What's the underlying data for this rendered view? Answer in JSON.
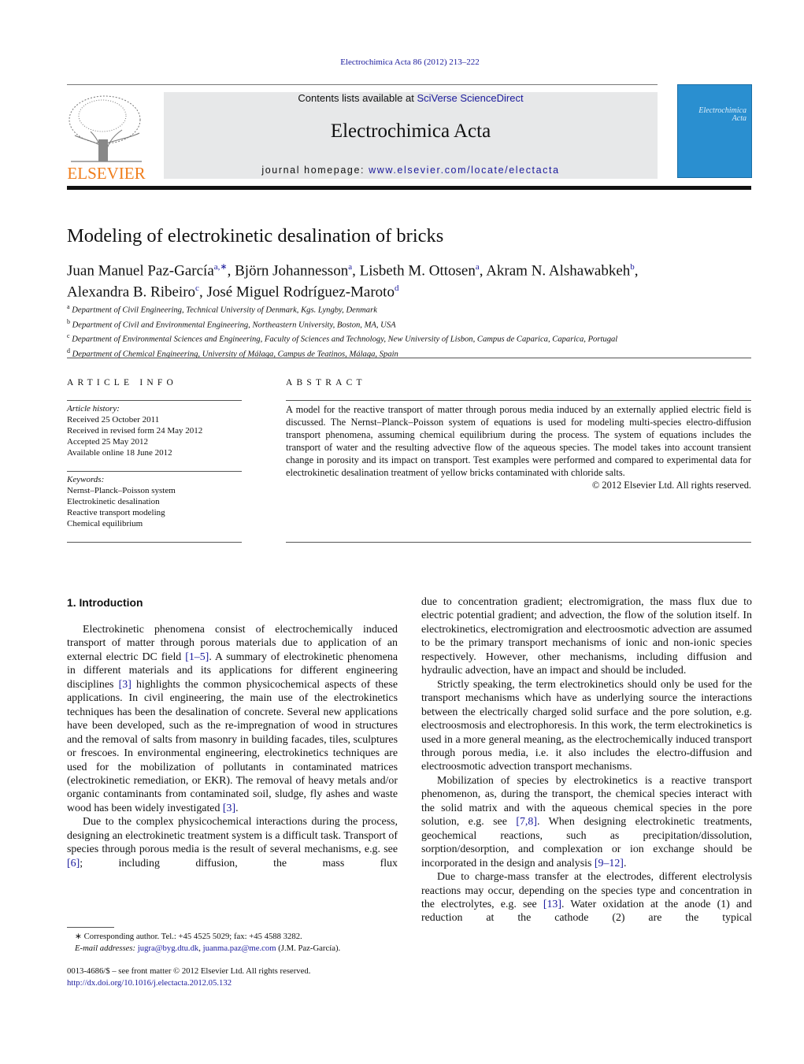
{
  "header": {
    "journal_ref": "Electrochimica Acta 86 (2012) 213–222",
    "contents_prefix": "Contents lists available at ",
    "contents_link": "SciVerse ScienceDirect",
    "journal_title": "Electrochimica Acta",
    "homepage_prefix": "journal homepage: ",
    "homepage_link": "www.elsevier.com/locate/electacta",
    "publisher_logo": "ELSEVIER",
    "cover_title": "Electrochimica Acta",
    "cover_color": "#2a8fd0"
  },
  "article": {
    "title": "Modeling of electrokinetic desalination of bricks",
    "authors": [
      {
        "name": "Juan Manuel Paz-García",
        "sup": "a,∗",
        "sep": ", "
      },
      {
        "name": "Björn Johannesson",
        "sup": "a",
        "sep": ", "
      },
      {
        "name": "Lisbeth M. Ottosen",
        "sup": "a",
        "sep": ", "
      },
      {
        "name": "Akram N. Alshawabkeh",
        "sup": "b",
        "sep": ","
      },
      {
        "name": "Alexandra B. Ribeiro",
        "sup": "c",
        "sep": ", "
      },
      {
        "name": "José Miguel Rodríguez-Maroto",
        "sup": "d",
        "sep": ""
      }
    ],
    "affiliations": [
      {
        "sup": "a",
        "text": "Department of Civil Engineering, Technical University of Denmark, Kgs. Lyngby, Denmark"
      },
      {
        "sup": "b",
        "text": "Department of Civil and Environmental Engineering, Northeastern University, Boston, MA, USA"
      },
      {
        "sup": "c",
        "text": "Department of Environmental Sciences and Engineering, Faculty of Sciences and Technology, New University of Lisbon, Campus de Caparica, Caparica, Portugal"
      },
      {
        "sup": "d",
        "text": "Department of Chemical Engineering, University of Málaga, Campus de Teatinos, Málaga, Spain"
      }
    ]
  },
  "article_info": {
    "heading": "ARTICLE INFO",
    "history_label": "Article history:",
    "history": [
      "Received 25 October 2011",
      "Received in revised form 24 May 2012",
      "Accepted 25 May 2012",
      "Available online 18 June 2012"
    ],
    "keywords_label": "Keywords:",
    "keywords": [
      "Nernst–Planck–Poisson system",
      "Electrokinetic desalination",
      "Reactive transport modeling",
      "Chemical equilibrium"
    ]
  },
  "abstract": {
    "heading": "ABSTRACT",
    "text": "A model for the reactive transport of matter through porous media induced by an externally applied electric field is discussed. The Nernst–Planck–Poisson system of equations is used for modeling multi-species electro-diffusion transport phenomena, assuming chemical equilibrium during the process. The system of equations includes the transport of water and the resulting advective flow of the aqueous species. The model takes into account transient change in porosity and its impact on transport. Test examples were performed and compared to experimental data for electrokinetic desalination treatment of yellow bricks contaminated with chloride salts.",
    "copyright": "© 2012 Elsevier Ltd. All rights reserved."
  },
  "body": {
    "section_heading": "1.  Introduction",
    "left_column": [
      {
        "style": "",
        "segments": [
          {
            "t": "Electrokinetic phenomena consist of electrochemically induced transport of matter through porous materials due to application of an external electric DC field "
          },
          {
            "t": "[1–5]",
            "ref": true
          },
          {
            "t": ". A summary of electrokinetic phe­nomena in different materials and its applications for different engineering disciplines "
          },
          {
            "t": "[3]",
            "ref": true
          },
          {
            "t": " highlights the common physicochem­ical aspects of these applications. In civil engineering, the main use of the electrokinetics techniques has been the desalination of concrete. Several new applications have been developed, such as the re-impregnation of wood in structures and the removal of salts from masonry in building facades, tiles, sculptures or fres­coes. In environmental engineering, electrokinetics techniques are used for the mobilization of pollutants in contaminated matri­ces (electrokinetic remediation, or EKR). The removal of heavy metals and/or organic contaminants from contaminated soil, sludge, fly ashes and waste wood has been widely investigated "
          },
          {
            "t": "[3]",
            "ref": true
          },
          {
            "t": "."
          }
        ]
      },
      {
        "style": "cont",
        "segments": [
          {
            "t": "Due to the complex physicochemical interactions during the process, designing an electrokinetic treatment system is a difficult task. Transport of species through porous media is the result of several mechanisms, e.g. see "
          },
          {
            "t": "[6]",
            "ref": true
          },
          {
            "t": "; including diffusion, the mass flux"
          }
        ]
      }
    ],
    "right_column": [
      {
        "style": "noind",
        "segments": [
          {
            "t": "due to concentration gradient; electromigration, the mass flux due to electric potential gradient; and advection, the flow of the solu­tion itself. In electrokinetics, electromigration and electroosmotic advection are assumed to be the primary transport mechanisms of ionic and non-ionic species respectively. However, other mecha­nisms, including diffusion and hydraulic advection, have an impact and should be included."
          }
        ]
      },
      {
        "style": "",
        "segments": [
          {
            "t": "Strictly speaking, the term electrokinetics should only be used for the transport mechanisms which have as underlying source the interactions between the electrically charged solid surface and the pore solution, e.g. electroosmosis and electrophoresis. In this work, the term electrokinetics is used in a more general meaning, as the electrochemically induced transport through porous media, i.e. it also includes the electro-diffusion and electroosmotic advection transport mechanisms."
          }
        ]
      },
      {
        "style": "",
        "segments": [
          {
            "t": "Mobilization of species by electrokinetics is a reactive trans­port phenomenon, as, during the transport, the chemical species interact with the solid matrix and with the aqueous chemi­cal species in the pore solution, e.g. see "
          },
          {
            "t": "[7,8]",
            "ref": true
          },
          {
            "t": ". When designing electrokinetic treatments, geochemical reactions, such as precip­itation/dissolution, sorption/desorption, and complexation or ion exchange should be incorporated in the design and analysis "
          },
          {
            "t": "[9–12]",
            "ref": true
          },
          {
            "t": "."
          }
        ]
      },
      {
        "style": "cont",
        "segments": [
          {
            "t": "Due to charge-mass transfer at the electrodes, different elec­trolysis reactions may occur, depending on the species type and concentration in the electrolytes, e.g. see "
          },
          {
            "t": "[13]",
            "ref": true
          },
          {
            "t": ". Water oxidation at the anode (1) and reduction at the cathode (2) are the typical"
          }
        ]
      }
    ]
  },
  "footnotes": {
    "corresponding": "∗ Corresponding author. Tel.: +45 4525 5029; fax: +45 4588 3282.",
    "email_label": "E-mail addresses: ",
    "email1": "jugra@byg.dtu.dk",
    "email_sep": ", ",
    "email2": "juanma.paz@me.com",
    "email_suffix": " (J.M. Paz-García).",
    "front_matter": "0013-4686/$ – see front matter © 2012 Elsevier Ltd. All rights reserved.",
    "doi": "http://dx.doi.org/10.1016/j.electacta.2012.05.132"
  }
}
